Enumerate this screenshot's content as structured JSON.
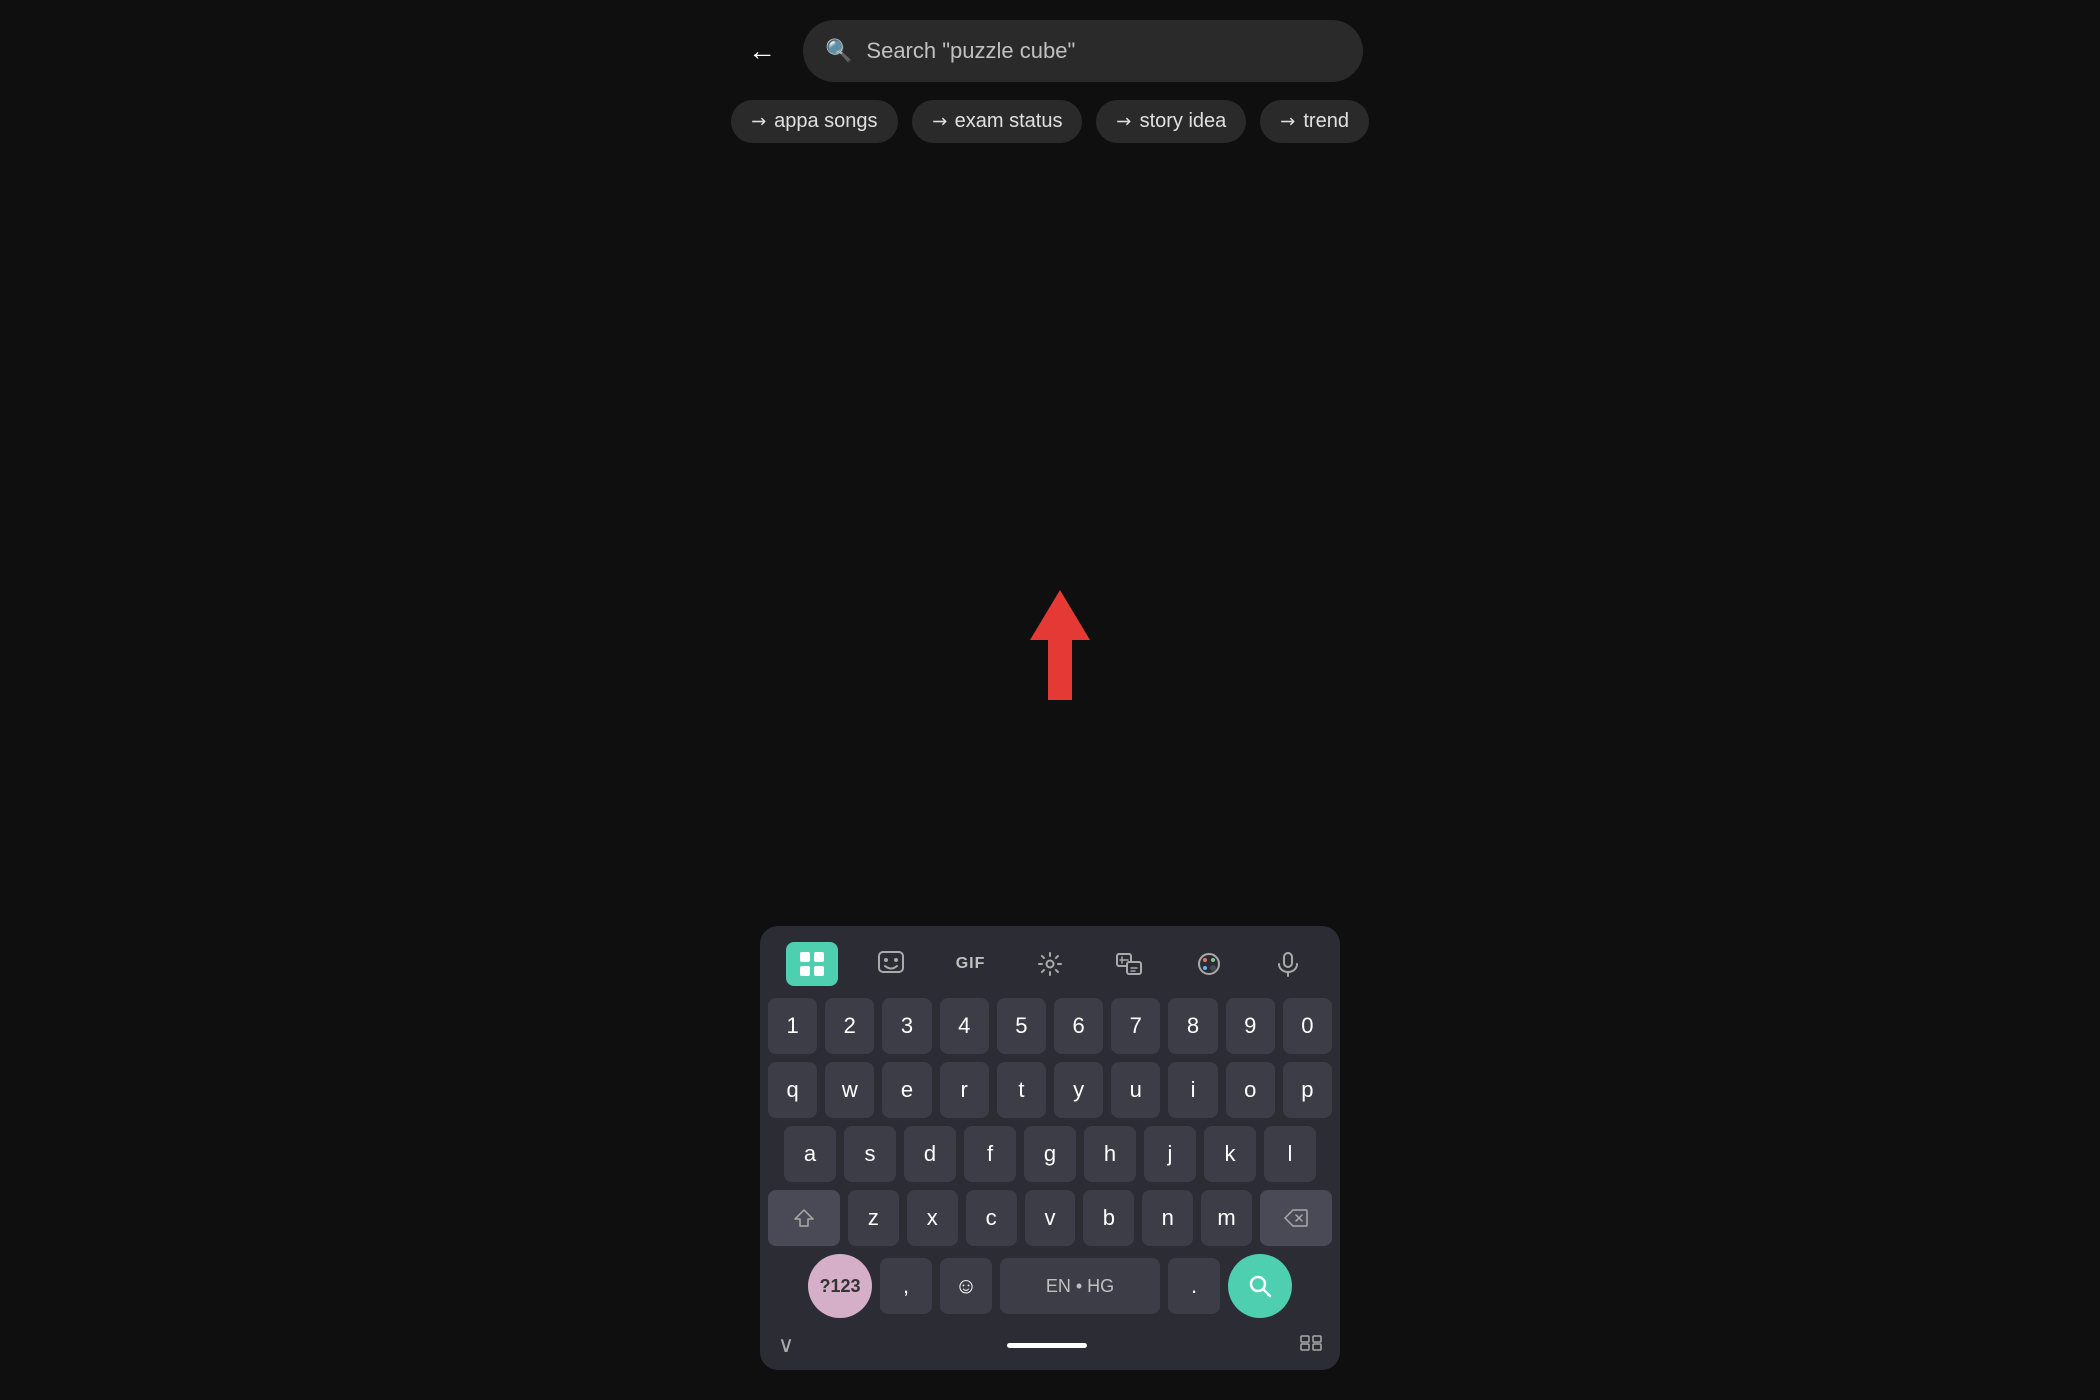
{
  "search": {
    "placeholder": "Search \"puzzle cube\"",
    "back_label": "←"
  },
  "chips": [
    {
      "id": "appa-songs",
      "label": "appa songs",
      "arrow": "↗"
    },
    {
      "id": "exam-status",
      "label": "exam status",
      "arrow": "↗"
    },
    {
      "id": "story-idea",
      "label": "story idea",
      "arrow": "↗"
    },
    {
      "id": "trend",
      "label": "trend",
      "arrow": "↗"
    }
  ],
  "keyboard": {
    "toolbar": [
      {
        "id": "apps",
        "icon": "⊞",
        "active": true
      },
      {
        "id": "sticker",
        "icon": "🙂",
        "active": false
      },
      {
        "id": "gif",
        "icon": "GIF",
        "active": false
      },
      {
        "id": "settings",
        "icon": "⚙",
        "active": false
      },
      {
        "id": "translate",
        "icon": "🔡",
        "active": false
      },
      {
        "id": "palette",
        "icon": "🎨",
        "active": false
      },
      {
        "id": "mic",
        "icon": "🎤",
        "active": false
      }
    ],
    "rows": [
      [
        "1",
        "2",
        "3",
        "4",
        "5",
        "6",
        "7",
        "8",
        "9",
        "0"
      ],
      [
        "q",
        "w",
        "e",
        "r",
        "t",
        "y",
        "u",
        "i",
        "o",
        "p"
      ],
      [
        "a",
        "s",
        "d",
        "f",
        "g",
        "h",
        "j",
        "k",
        "l"
      ],
      [
        "z",
        "x",
        "c",
        "v",
        "b",
        "n",
        "m"
      ]
    ],
    "num_sym_label": "?123",
    "emoji_label": "☺",
    "lang_label": "EN • HG",
    "period_label": ".",
    "comma_label": ",",
    "search_icon": "🔍",
    "backspace_icon": "⌫",
    "shift_icon": "⇧",
    "nav_chevron": "∨",
    "keyboard_grid_icon": "⊞"
  }
}
